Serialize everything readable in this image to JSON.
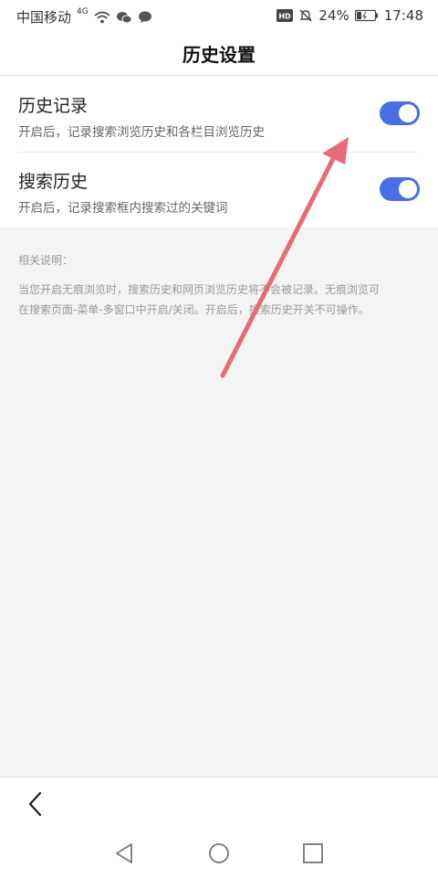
{
  "status_bar": {
    "carrier": "中国移动",
    "network": "4G",
    "battery_percent": "24%",
    "time": "17:48",
    "hd_badge": "HD",
    "icons": [
      "signal-4g-icon",
      "wifi-icon",
      "wechat-icon",
      "message-icon",
      "hd-icon",
      "mute-bell-icon",
      "battery-icon"
    ]
  },
  "page": {
    "title": "历史设置"
  },
  "settings": [
    {
      "label": "历史记录",
      "description": "开启后，记录搜索浏览历史和各栏目浏览历史",
      "enabled": true
    },
    {
      "label": "搜索历史",
      "description": "开启后，记录搜索框内搜索过的关键词",
      "enabled": true
    }
  ],
  "note": {
    "title": "相关说明：",
    "lines": [
      "当您开启无痕浏览时，搜索历史和网页浏览历史将不会被记录。无痕浏览可",
      "在搜索页面-菜单-多窗口中开启/关闭。开启后，搜索历史开关不可操作。"
    ]
  },
  "colors": {
    "toggle_on": "#4a6fe3",
    "annotation_arrow": "#e86a78",
    "background": "#f4f4f4"
  },
  "bottom": {
    "back_icon": "chevron-left-icon",
    "nav_icons": [
      "nav-back-triangle-icon",
      "nav-home-circle-icon",
      "nav-recents-square-icon"
    ]
  }
}
